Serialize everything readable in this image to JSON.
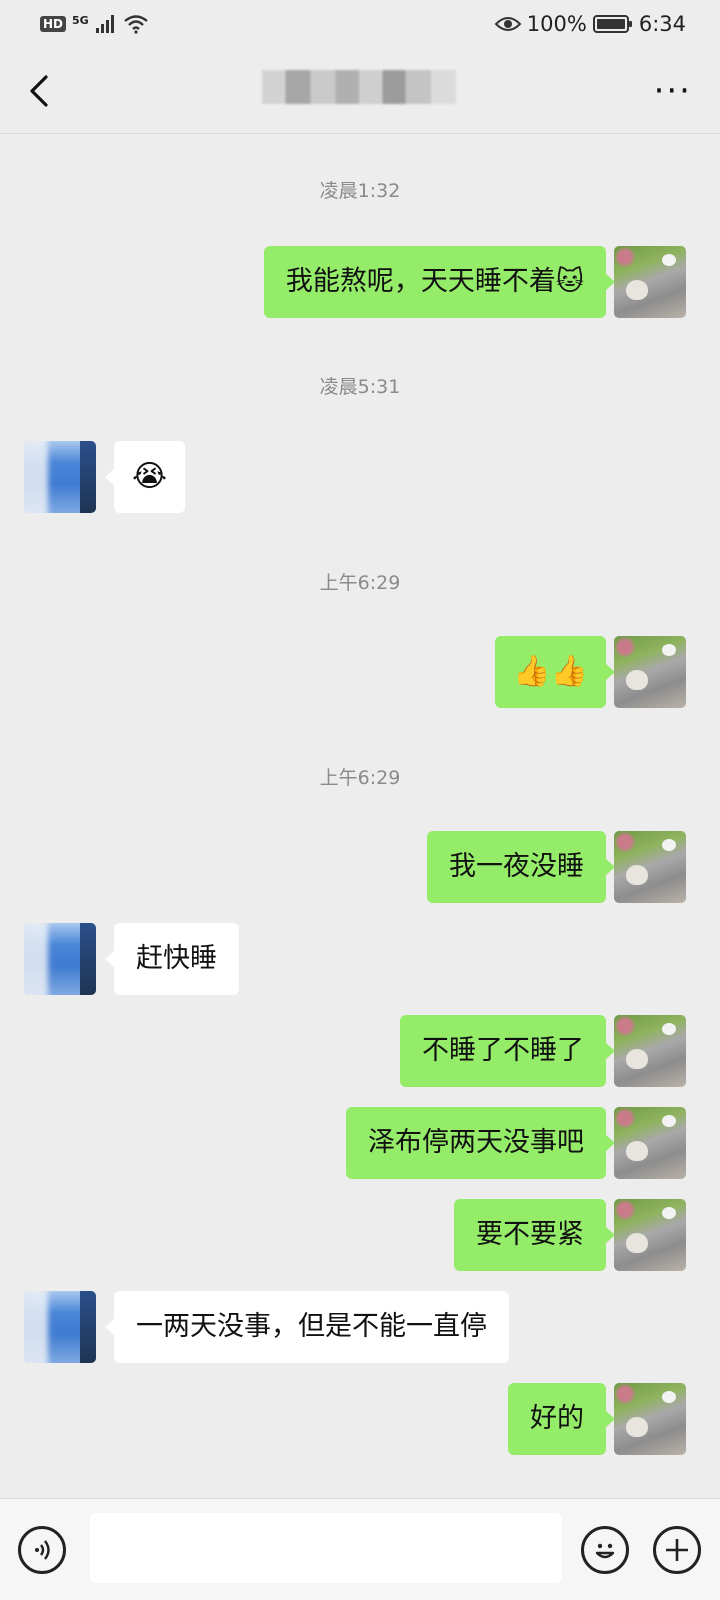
{
  "status_bar": {
    "hd": "HD",
    "network": "5G",
    "battery": "100%",
    "time": "6:34"
  },
  "header": {
    "back_icon": "chevron-left-icon",
    "more_icon": "more-dots-icon",
    "more_label": "···"
  },
  "timestamps": [
    "凌晨1:32",
    "凌晨5:31",
    "上午6:29",
    "上午6:29"
  ],
  "messages": [
    {
      "side": "out",
      "text": "我能熬呢，天天睡不着🐱"
    },
    {
      "side": "in",
      "text": "😭"
    },
    {
      "side": "out",
      "text": "👍👍"
    },
    {
      "side": "out",
      "text": "我一夜没睡"
    },
    {
      "side": "in",
      "text": "赶快睡"
    },
    {
      "side": "out",
      "text": "不睡了不睡了"
    },
    {
      "side": "out",
      "text": "泽布停两天没事吧"
    },
    {
      "side": "out",
      "text": "要不要紧"
    },
    {
      "side": "in",
      "text": "一两天没事，但是不能一直停"
    },
    {
      "side": "out",
      "text": "好的"
    }
  ],
  "input_bar": {
    "voice_icon": "voice-icon",
    "emoji_icon": "emoji-face-icon",
    "plus_icon": "plus-icon",
    "placeholder": ""
  }
}
